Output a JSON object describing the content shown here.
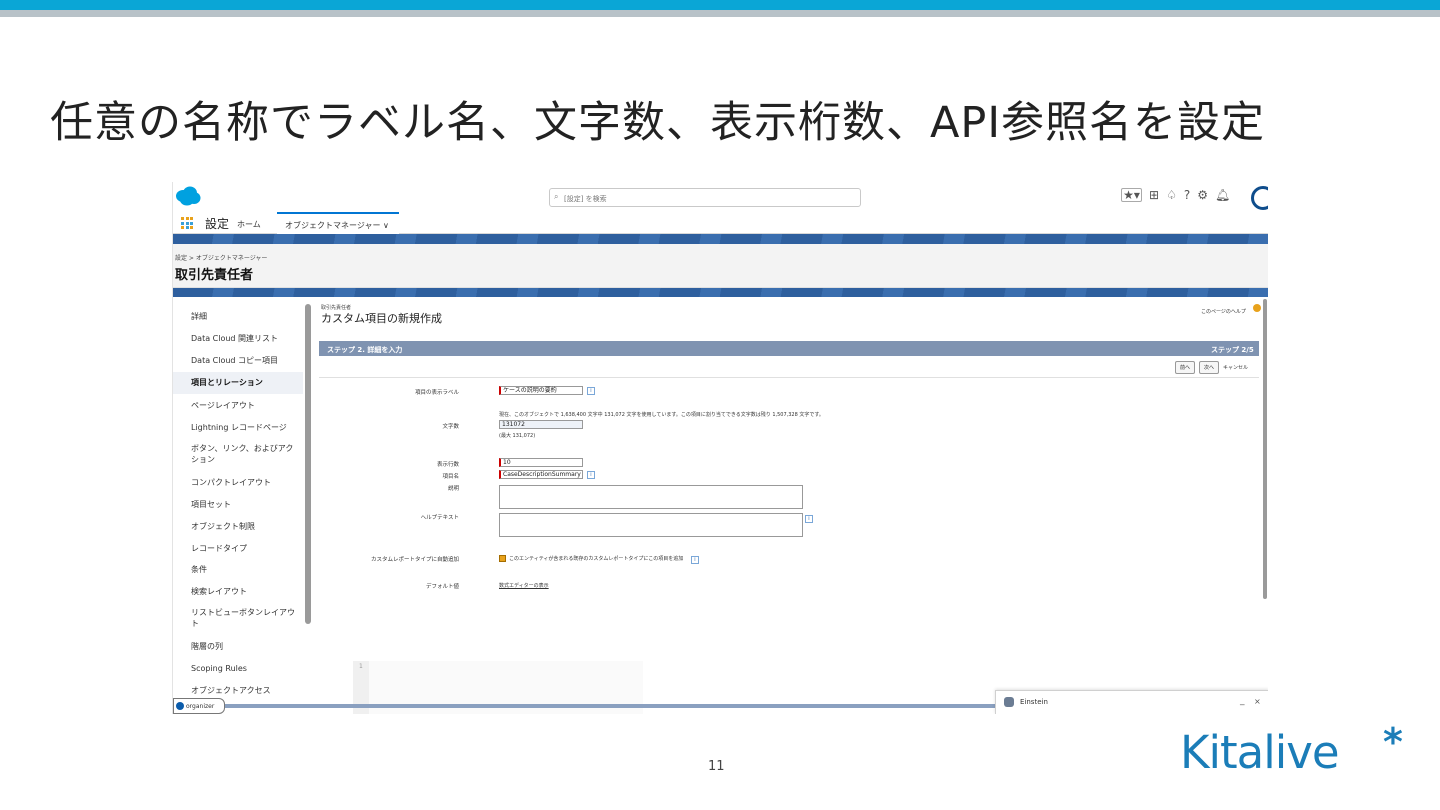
{
  "slide": {
    "title": "任意の名称でラベル名、文字数、表示桁数、API参照名を設定",
    "page_number": "11",
    "logo_text": "Kitalive",
    "logo_mark": "*"
  },
  "header": {
    "search_placeholder": "[設定] を検索",
    "icons": [
      "star-icon",
      "plus-icon",
      "trailhead-icon",
      "help-icon",
      "gear-icon",
      "bell-icon",
      "avatar"
    ]
  },
  "nav": {
    "app_name": "設定",
    "home_label": "ホーム",
    "active_tab": "オブジェクトマネージャー ∨"
  },
  "page_header": {
    "breadcrumb": "設定 > オブジェクトマネージャー",
    "object_title": "取引先責任者"
  },
  "sidebar": {
    "items": [
      {
        "label": "詳細",
        "active": false
      },
      {
        "label": "Data Cloud 関連リスト",
        "active": false
      },
      {
        "label": "Data Cloud コピー項目",
        "active": false
      },
      {
        "label": "項目とリレーション",
        "active": true
      },
      {
        "label": "ページレイアウト",
        "active": false
      },
      {
        "label": "Lightning レコードページ",
        "active": false
      },
      {
        "label": "ボタン、リンク、およびアクション",
        "active": false
      },
      {
        "label": "コンパクトレイアウト",
        "active": false
      },
      {
        "label": "項目セット",
        "active": false
      },
      {
        "label": "オブジェクト制限",
        "active": false
      },
      {
        "label": "レコードタイプ",
        "active": false
      },
      {
        "label": "条件",
        "active": false
      },
      {
        "label": "検索レイアウト",
        "active": false
      },
      {
        "label": "リストビューボタンレイアウト",
        "active": false
      },
      {
        "label": "階層の列",
        "active": false
      },
      {
        "label": "Scoping Rules",
        "active": false
      },
      {
        "label": "オブジェクトアクセス",
        "active": false
      }
    ]
  },
  "content": {
    "object_small": "取引先責任者",
    "title": "カスタム項目の新規作成",
    "help_link": "このページのヘルプ",
    "step_left": "ステップ 2. 詳細を入力",
    "step_right": "ステップ 2/5",
    "buttons": {
      "prev": "前へ",
      "next": "次へ",
      "cancel": "キャンセル"
    },
    "form": {
      "field_label_label": "項目の表示ラベル",
      "field_label_value": "ケースの説明の要約",
      "usage_note": "現在、このオブジェクトで 1,638,400 文字中 131,072 文字を使用しています。この項目に割り当てできる文字数は残り 1,507,328 文字です。",
      "length_label": "文字数",
      "length_value": "131072",
      "length_max": "(最大 131,072)",
      "lines_label": "表示行数",
      "lines_value": "10",
      "name_label": "項目名",
      "name_value": "CaseDescriptionSummary",
      "desc_label": "説明",
      "help_label": "ヘルプテキスト",
      "report_label": "カスタムレポートタイプに自動追加",
      "report_checkbox_text": "このエンティティが含まれる既存のカスタムレポートタイプにこの項目を追加",
      "default_label": "デフォルト値",
      "formula_link": "数式エディターの表示",
      "editor_line": "1"
    }
  },
  "utility": {
    "einstein_label": "Einstein",
    "minimize": "_",
    "close": "×",
    "organizer": "organizer"
  },
  "colors": {
    "top_accent": "#0aa6d6",
    "sf_band": "#2e5f9e",
    "step_bar": "#7f93b1",
    "logo": "#1b7db8"
  }
}
